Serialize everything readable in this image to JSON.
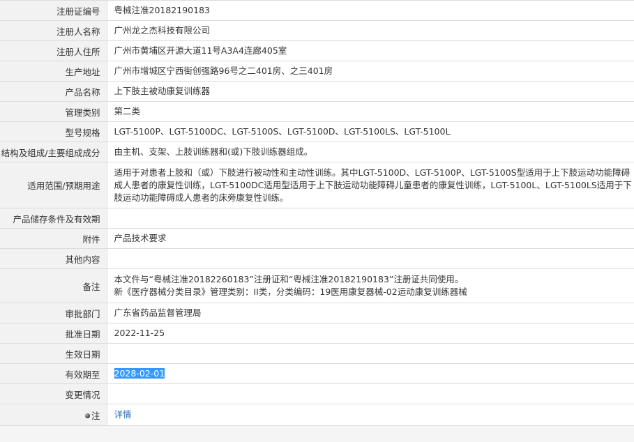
{
  "rows": [
    {
      "label": "注册证编号",
      "value": "粤械注准20182190183"
    },
    {
      "label": "注册人名称",
      "value": "广州龙之杰科技有限公司"
    },
    {
      "label": "注册人住所",
      "value": "广州市黄埔区开源大道11号A3A4连廊405室"
    },
    {
      "label": "生产地址",
      "value": "广州市增城区宁西街创强路96号之二401房、之三401房"
    },
    {
      "label": "产品名称",
      "value": "上下肢主被动康复训练器"
    },
    {
      "label": "管理类别",
      "value": "第二类"
    },
    {
      "label": "型号规格",
      "value": "LGT-5100P、LGT-5100DC、LGT-5100S、LGT-5100D、LGT-5100LS、LGT-5100L"
    },
    {
      "label": "结构及组成/主要组成成分",
      "value": "由主机、支架、上肢训练器和(或)下肢训练器组成。"
    },
    {
      "label": "适用范围/预期用途",
      "value": "适用于对患者上肢和（或）下肢进行被动性和主动性训练。其中LGT-5100D、LGT-5100P、LGT-5100S型适用于上下肢运动功能障碍成人患者的康复性训练，LGT-5100DC适用型适用于上下肢运动功能障碍儿童患者的康复性训练，LGT-5100L、LGT-5100LS适用于下肢运动功能障碍成人患者的床旁康复性训练。"
    },
    {
      "label": "产品储存条件及有效期",
      "value": ""
    },
    {
      "label": "附件",
      "value": "产品技术要求"
    },
    {
      "label": "其他内容",
      "value": ""
    },
    {
      "label": "备注",
      "value_line1": "本文件与“粤械注准20182260183”注册证和“粤械注准20182190183”注册证共同使用。",
      "value_line2": "新《医疗器械分类目录》管理类别：II类，分类编码：19医用康复器械-02运动康复训练器械"
    },
    {
      "label": "审批部门",
      "value": "广东省药品监督管理局"
    },
    {
      "label": "批准日期",
      "value": "2022-11-25"
    },
    {
      "label": "生效日期",
      "value": ""
    },
    {
      "label": "有效期至",
      "value": "2028-02-01"
    },
    {
      "label": "变更情况",
      "value": ""
    },
    {
      "label": "注",
      "value": "详情"
    }
  ],
  "selection_color": "#3399ff",
  "link_color": "#2a6db8"
}
